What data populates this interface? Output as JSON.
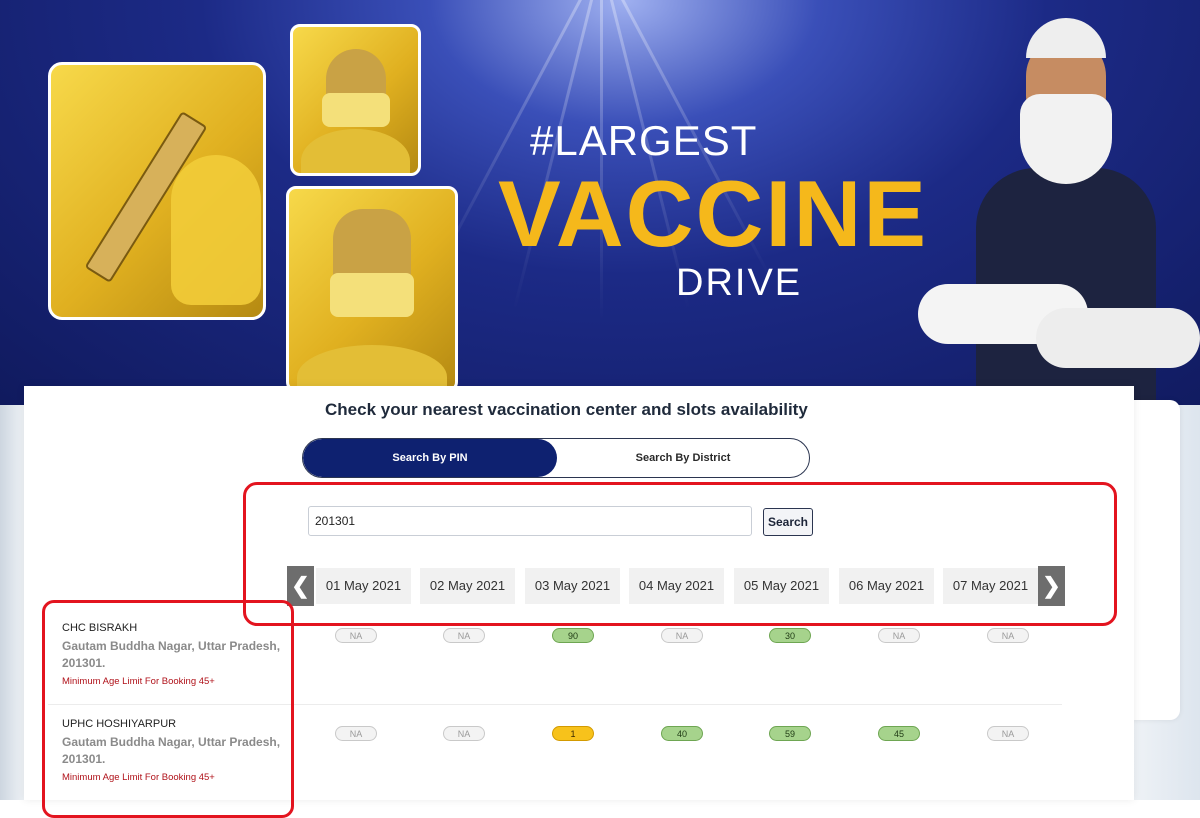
{
  "banner": {
    "line1": "#LARGEST",
    "line2": "VACCINE",
    "line3": "DRIVE",
    "accent_color": "#f5b81b",
    "bg_color": "#1c2a86"
  },
  "search": {
    "title": "Check your nearest vaccination center and slots availability",
    "tabs": [
      {
        "label": "Search By PIN",
        "active": true
      },
      {
        "label": "Search By District",
        "active": false
      }
    ],
    "pin_value": "201301",
    "button_label": "Search"
  },
  "dates": {
    "prev_icon": "chevron-left-icon",
    "next_icon": "chevron-right-icon",
    "items": [
      "01 May 2021",
      "02 May 2021",
      "03 May 2021",
      "04 May 2021",
      "05 May 2021",
      "06 May 2021",
      "07 May 2021"
    ]
  },
  "centers": [
    {
      "name": "CHC BISRAKH",
      "address": "Gautam Buddha Nagar, Uttar Pradesh, 201301.",
      "age_limit": "Minimum Age Limit For Booking 45+",
      "slots": [
        {
          "label": "NA",
          "status": "na"
        },
        {
          "label": "NA",
          "status": "na"
        },
        {
          "label": "90",
          "status": "green"
        },
        {
          "label": "NA",
          "status": "na"
        },
        {
          "label": "30",
          "status": "green"
        },
        {
          "label": "NA",
          "status": "na"
        },
        {
          "label": "NA",
          "status": "na"
        }
      ]
    },
    {
      "name": "UPHC HOSHIYARPUR",
      "address": "Gautam Buddha Nagar, Uttar Pradesh, 201301.",
      "age_limit": "Minimum Age Limit For Booking 45+",
      "slots": [
        {
          "label": "NA",
          "status": "na"
        },
        {
          "label": "NA",
          "status": "na"
        },
        {
          "label": "1",
          "status": "yellow"
        },
        {
          "label": "40",
          "status": "green"
        },
        {
          "label": "59",
          "status": "green"
        },
        {
          "label": "45",
          "status": "green"
        },
        {
          "label": "NA",
          "status": "na"
        }
      ]
    }
  ],
  "colors": {
    "active_tab": "#0e2170",
    "highlight": "#e3141f",
    "slot_available": "#a6d38c",
    "slot_low": "#f7c21b"
  }
}
